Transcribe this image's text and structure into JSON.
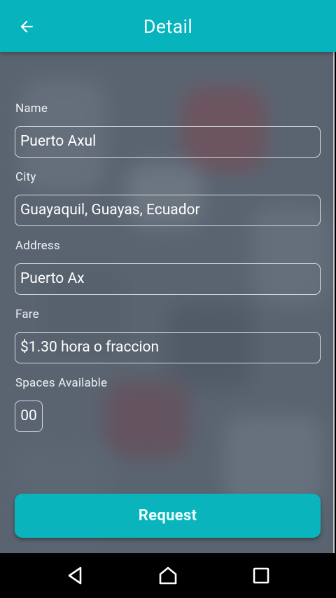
{
  "header": {
    "back_icon": "arrow-left-icon",
    "title": "Detail"
  },
  "form": {
    "name_label": "Name",
    "name_value": "Puerto Axul",
    "city_label": "City",
    "city_value": "Guayaquil, Guayas, Ecuador",
    "address_label": "Address",
    "address_value": "Puerto Ax",
    "fare_label": "Fare",
    "fare_value": "$1.30 hora o fraccion",
    "spaces_label": "Spaces Available",
    "spaces_value": "00"
  },
  "actions": {
    "request_label": "Request"
  },
  "system_nav": {
    "back_icon": "triangle-back-icon",
    "home_icon": "home-icon",
    "recents_icon": "square-recents-icon"
  },
  "colors": {
    "accent": "#07b3bc",
    "background": "#5a6571"
  }
}
